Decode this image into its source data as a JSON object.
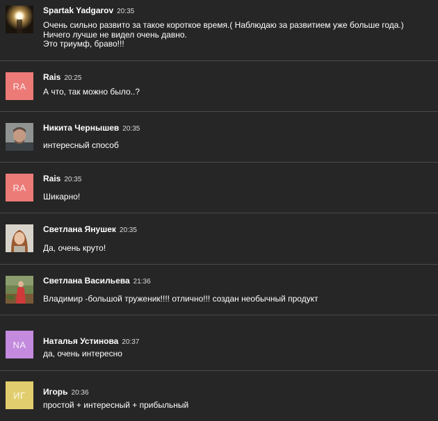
{
  "comments": [
    {
      "author": "Spartak Yadgarov",
      "time": "20:35",
      "text": "Очень сильно развито за такое короткое время.( Наблюдаю за развитием уже больше года.)\nНичего лучше не видел очень давно.\nЭто триумф, браво!!!",
      "avatar": {
        "type": "photo",
        "icon": "lamp-photo-avatar"
      }
    },
    {
      "author": "Rais",
      "time": "20:25",
      "text": "А что, так можно было..?",
      "avatar": {
        "type": "initials",
        "initials": "RA",
        "color": "#ec7b78"
      }
    },
    {
      "author": "Никита Чернышев",
      "time": "20:35",
      "text": "интересный способ",
      "avatar": {
        "type": "photo",
        "icon": "man-photo-avatar"
      }
    },
    {
      "author": "Rais",
      "time": "20:35",
      "text": "Шикарно!",
      "avatar": {
        "type": "initials",
        "initials": "RA",
        "color": "#ec7b78"
      }
    },
    {
      "author": "Светлана Янушек",
      "time": "20:35",
      "text": "Да, очень круто!",
      "avatar": {
        "type": "photo",
        "icon": "woman-photo-avatar"
      }
    },
    {
      "author": "Светлана Васильева",
      "time": "21:36",
      "text": "Владимир -большой труженик!!!! отлично!!! создан необычный продукт",
      "avatar": {
        "type": "photo",
        "icon": "garden-photo-avatar"
      }
    },
    {
      "author": "Наталья Устинова",
      "time": "20:37",
      "text": "да, очень интересно",
      "avatar": {
        "type": "initials",
        "initials": "NA",
        "color": "#c38ade"
      }
    },
    {
      "author": "Игорь",
      "time": "20:36",
      "text": "простой + интересный + прибыльный",
      "avatar": {
        "type": "initials",
        "initials": "ИГ",
        "color": "#e2cd6e"
      }
    }
  ]
}
